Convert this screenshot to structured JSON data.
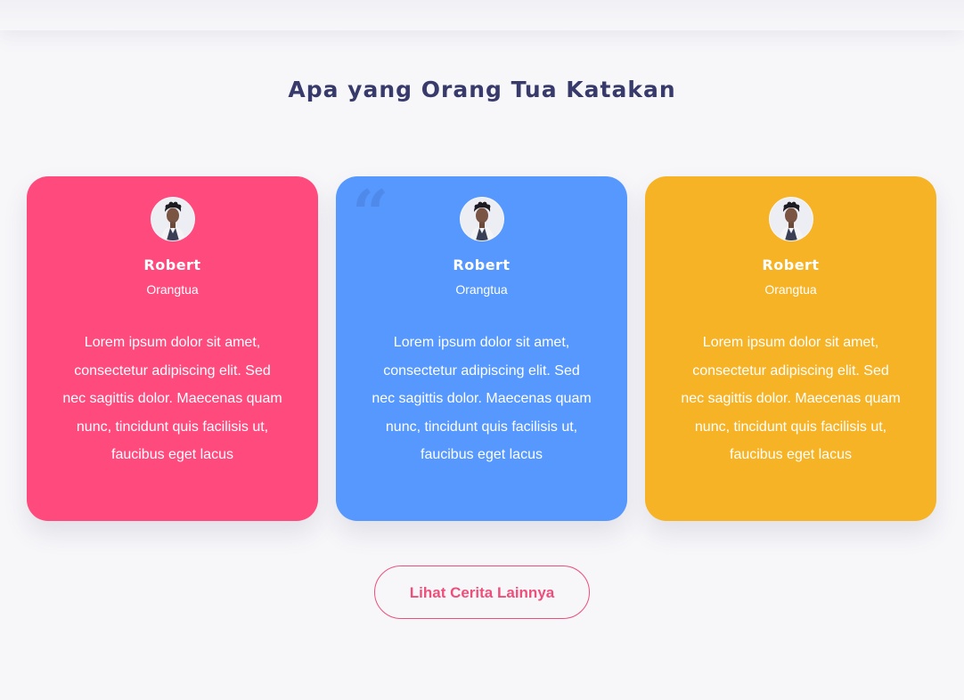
{
  "section": {
    "title": "Apa yang Orang Tua Katakan"
  },
  "testimonials": [
    {
      "name": "Robert",
      "role": "Orangtua",
      "text": "Lorem ipsum dolor sit amet, consectetur adipiscing elit. Sed nec sagittis dolor. Maecenas quam nunc, tincidunt quis facilisis ut, faucibus eget lacus",
      "color": "#ff4a7e",
      "show_quote_icon": false
    },
    {
      "name": "Robert",
      "role": "Orangtua",
      "text": "Lorem ipsum dolor sit amet, consectetur adipiscing elit. Sed nec sagittis dolor. Maecenas quam nunc, tincidunt quis facilisis ut, faucibus eget lacus",
      "color": "#5698fd",
      "show_quote_icon": true
    },
    {
      "name": "Robert",
      "role": "Orangtua",
      "text": "Lorem ipsum dolor sit amet, consectetur adipiscing elit. Sed nec sagittis dolor. Maecenas quam nunc, tincidunt quis facilisis ut, faucibus eget lacus",
      "color": "#f6b326",
      "show_quote_icon": false
    }
  ],
  "quote_icon_glyph": "“",
  "more_button": {
    "label": "Lihat Cerita Lainnya",
    "color": "#ee4f7a"
  }
}
